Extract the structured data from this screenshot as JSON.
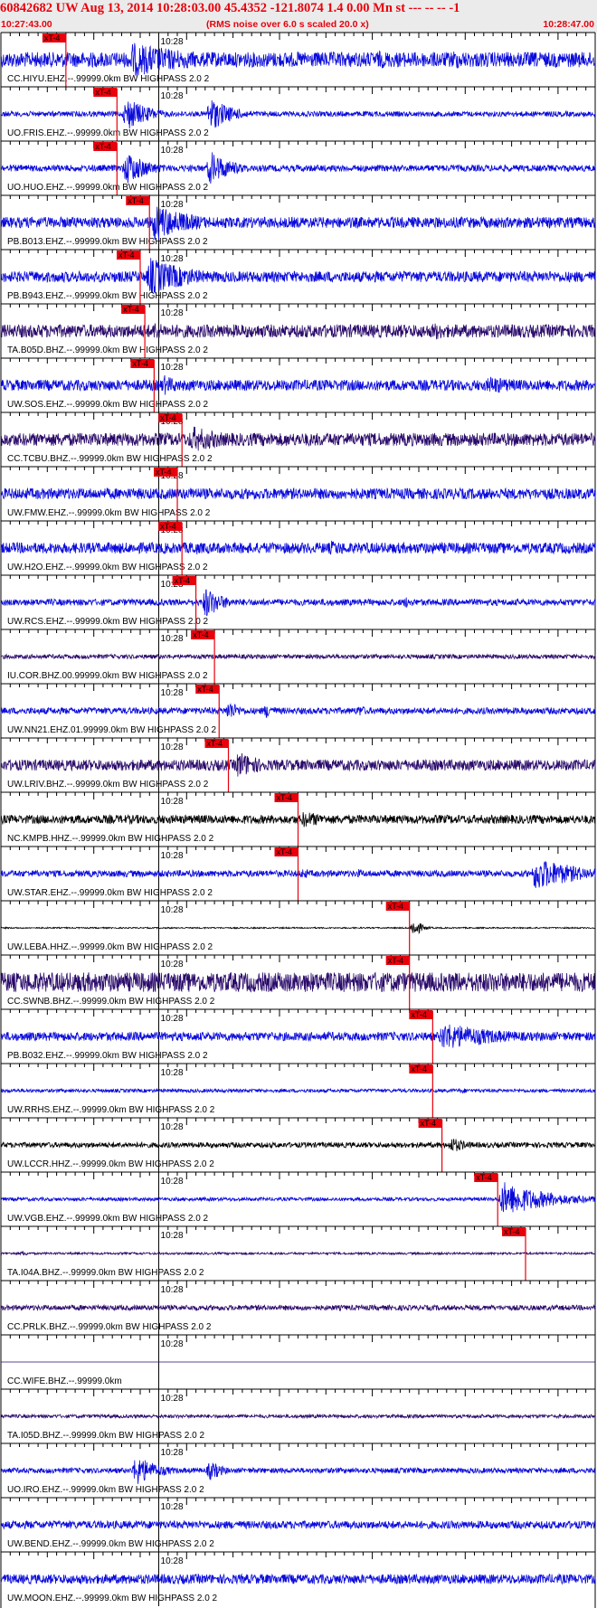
{
  "header": {
    "title": "60842682 UW Aug 13, 2014 10:28:03.00   45.4352 -121.8074  1.4 0.00 Mn st --- -- --  -1",
    "start_time": "10:27:43.00",
    "subtitle": "(RMS noise over 6.0 s scaled 20.0 x)",
    "end_time": "10:28:47.00"
  },
  "colors": {
    "pick": "#e8000b",
    "blue": "#0a0adc",
    "purple": "#2a0a6a",
    "black": "#000000",
    "header_bg": "#ebebeb"
  },
  "chart_data": {
    "type": "line",
    "x_range_seconds": [
      0,
      64
    ],
    "minute_mark_label": "10:28",
    "minute_mark_second": 17,
    "pick_label": "xT-4",
    "traces": [
      {
        "label": "CC.HIYU.EHZ.--.99999.0km BW HIGHPASS  2.0  2",
        "color": "blue",
        "pick_s": 7.0,
        "amp": 0.35,
        "events": [
          [
            13.5,
            18,
            0.85
          ],
          [
            40,
            15,
            0.45
          ],
          [
            48,
            12,
            0.5
          ]
        ]
      },
      {
        "label": "UO.FRIS.EHZ.--.99999.0km BW  HIGHPASS  2.0  2",
        "color": "blue",
        "pick_s": 12.5,
        "amp": 0.12,
        "events": [
          [
            13,
            5,
            1.0
          ],
          [
            22,
            5,
            1.0
          ],
          [
            41,
            3,
            0.2
          ]
        ]
      },
      {
        "label": "UO.HUO.EHZ.--.99999.0km BW  HIGHPASS  2.0  2",
        "color": "blue",
        "pick_s": 12.5,
        "amp": 0.15,
        "events": [
          [
            13,
            5,
            1.0
          ],
          [
            22,
            5,
            1.0
          ]
        ]
      },
      {
        "label": "PB.B013.EHZ.--.99999.0km BW  HIGHPASS  2.0  2",
        "color": "blue",
        "pick_s": 16.0,
        "amp": 0.25,
        "events": [
          [
            16,
            9,
            1.0
          ]
        ]
      },
      {
        "label": "PB.B943.EHZ.--.99999.0km BW  HIGHPASS  2.0  2",
        "color": "blue",
        "pick_s": 15.0,
        "amp": 0.25,
        "events": [
          [
            15.5,
            10,
            1.0
          ]
        ]
      },
      {
        "label": "TA.B05D.BHZ.--.99999.0km BW  HIGHPASS  2.0  2",
        "color": "purple",
        "pick_s": 15.5,
        "amp": 0.3,
        "events": [
          [
            16,
            4,
            0.6
          ],
          [
            46,
            8,
            0.5
          ]
        ]
      },
      {
        "label": "UW.SOS.EHZ.--.99999.0km BW  HIGHPASS  2.0  2",
        "color": "blue",
        "pick_s": 16.5,
        "amp": 0.25,
        "events": [
          [
            17,
            5,
            0.6
          ],
          [
            52,
            10,
            0.5
          ]
        ]
      },
      {
        "label": "CC.TCBU.BHZ.--.99999.0km BW  HIGHPASS  2.0  2",
        "color": "purple",
        "pick_s": 19.5,
        "amp": 0.3,
        "events": [
          [
            20,
            10,
            0.7
          ]
        ]
      },
      {
        "label": "UW.FMW.EHZ.--.99999.0km BW  HIGHPASS  2.0  2",
        "color": "blue",
        "pick_s": 19.0,
        "amp": 0.25,
        "events": [
          [
            20,
            4,
            0.5
          ]
        ]
      },
      {
        "label": "UW.H2O.EHZ.--.99999.0km BW  HIGHPASS  2.0  2",
        "color": "blue",
        "pick_s": 19.5,
        "amp": 0.25,
        "events": [
          [
            20,
            4,
            0.5
          ],
          [
            35,
            10,
            0.4
          ]
        ]
      },
      {
        "label": "UW.RCS.EHZ.--.99999.0km BW  HIGHPASS  2.0  2",
        "color": "blue",
        "pick_s": 21.0,
        "amp": 0.15,
        "events": [
          [
            21.5,
            4,
            1.0
          ],
          [
            43,
            3,
            0.4
          ]
        ]
      },
      {
        "label": "IU.COR.BHZ.00.99999.0km BW  HIGHPASS  2.0  2",
        "color": "purple",
        "pick_s": 23.0,
        "amp": 0.1,
        "events": []
      },
      {
        "label": "UW.NN21.EHZ.01.99999.0km BW  HIGHPASS  2.0  2",
        "color": "blue",
        "pick_s": 23.5,
        "amp": 0.15,
        "events": [
          [
            24,
            3,
            0.7
          ],
          [
            28,
            3,
            0.5
          ],
          [
            38,
            3,
            0.4
          ]
        ]
      },
      {
        "label": "UW.LRIV.BHZ.--.99999.0km BW  HIGHPASS  2.0  2",
        "color": "purple",
        "pick_s": 24.5,
        "amp": 0.25,
        "events": [
          [
            25,
            6,
            0.8
          ]
        ]
      },
      {
        "label": "NC.KMPB.HHZ.--.99999.0km BW  HIGHPASS  2.0  2",
        "color": "black",
        "pick_s": 32.0,
        "amp": 0.2,
        "events": [
          [
            32,
            8,
            0.45
          ]
        ]
      },
      {
        "label": "UW.STAR.EHZ.--.99999.0km BW  HIGHPASS  2.0  2",
        "color": "blue",
        "pick_s": 32.0,
        "amp": 0.15,
        "events": [
          [
            32,
            2,
            0.5
          ],
          [
            38,
            2,
            0.4
          ],
          [
            57,
            10,
            0.9
          ]
        ]
      },
      {
        "label": "UW.LEBA.HHZ.--.99999.0km BW  HIGHPASS  2.0  2",
        "color": "black",
        "pick_s": 44.0,
        "amp": 0.03,
        "events": [
          [
            44,
            1.5,
            0.95
          ]
        ]
      },
      {
        "label": "CC.SWNB.BHZ.--.99999.0km BW  HIGHPASS  2.0  2",
        "color": "purple",
        "pick_s": 44.0,
        "amp": 0.45,
        "events": [
          [
            45,
            3,
            0.7
          ]
        ]
      },
      {
        "label": "PB.B032.EHZ.--.99999.0km BW  HIGHPASS  2.0  2",
        "color": "blue",
        "pick_s": 46.5,
        "amp": 0.2,
        "events": [
          [
            47,
            15,
            0.7
          ]
        ]
      },
      {
        "label": "UW.RRHS.EHZ.--.99999.0km BW  HIGHPASS  2.0  2",
        "color": "blue",
        "pick_s": 46.5,
        "amp": 0.08,
        "events": [
          [
            49,
            3,
            0.2
          ]
        ]
      },
      {
        "label": "UW.LCCR.HHZ.--.99999.0km BW  HIGHPASS  2.0  2",
        "color": "black",
        "pick_s": 47.5,
        "amp": 0.12,
        "events": [
          [
            48,
            4,
            0.5
          ]
        ]
      },
      {
        "label": "UW.VGB.EHZ.--.99999.0km BW  HIGHPASS  2.0  2",
        "color": "blue",
        "pick_s": 53.5,
        "amp": 0.08,
        "events": [
          [
            53.5,
            11,
            0.9
          ]
        ]
      },
      {
        "label": "TA.I04A.BHZ.--.99999.0km BW  HIGHPASS  2.0  2",
        "color": "purple",
        "pick_s": 56.5,
        "amp": 0.05,
        "events": [
          [
            2,
            1,
            0.4
          ]
        ]
      },
      {
        "label": "CC.PRLK.BHZ.--.99999.0km BW  HIGHPASS  2.0  2",
        "color": "purple",
        "pick_s": null,
        "amp": 0.12,
        "events": []
      },
      {
        "label": "CC.WIFE.BHZ.--.99999.0km",
        "color": "purple",
        "pick_s": null,
        "amp": 0.0,
        "events": []
      },
      {
        "label": "TA.I05D.BHZ.--.99999.0km BW  HIGHPASS  2.0  2",
        "color": "purple",
        "pick_s": null,
        "amp": 0.08,
        "events": []
      },
      {
        "label": "UO.IRO.EHZ.--.99999.0km BW  HIGHPASS  2.0  2",
        "color": "blue",
        "pick_s": null,
        "amp": 0.12,
        "events": [
          [
            14,
            5,
            0.9
          ],
          [
            22,
            3,
            0.7
          ]
        ]
      },
      {
        "label": "UW.BEND.EHZ.--.99999.0km BW  HIGHPASS  2.0  2",
        "color": "blue",
        "pick_s": null,
        "amp": 0.18,
        "events": []
      },
      {
        "label": "UW.MOON.EHZ.--.99999.0km BW  HIGHPASS  2.0  2",
        "color": "blue",
        "pick_s": null,
        "amp": 0.22,
        "events": []
      }
    ]
  }
}
